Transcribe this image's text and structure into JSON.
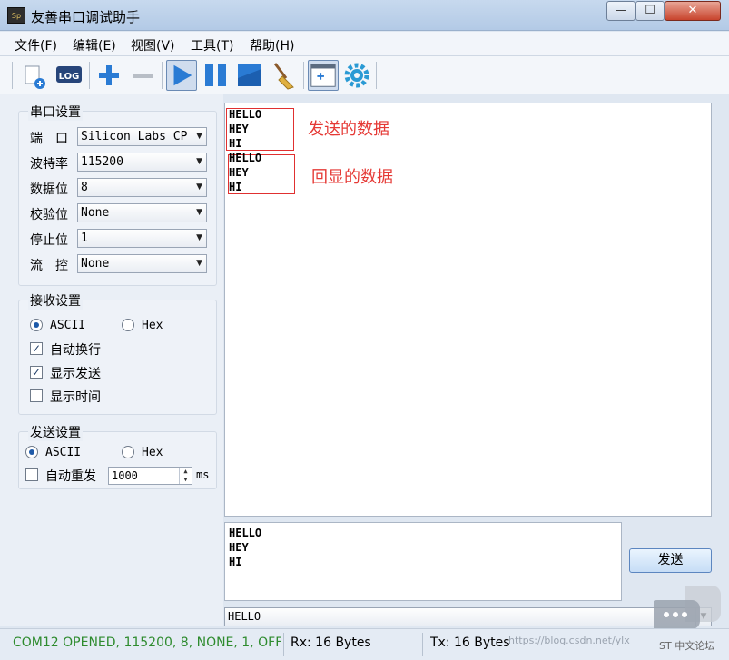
{
  "window": {
    "title": "友善串口调试助手",
    "app_icon_text": "Sp",
    "min_glyph": "—",
    "max_glyph": "☐",
    "close_glyph": "✕"
  },
  "menu": [
    "文件(F)",
    "编辑(E)",
    "视图(V)",
    "工具(T)",
    "帮助(H)"
  ],
  "toolbar": {
    "icons": [
      "new-icon",
      "log-icon",
      "add-icon",
      "remove-icon",
      "start-icon",
      "pause-icon",
      "stop-icon",
      "clear-broom-icon",
      "window-icon",
      "settings-gear-icon"
    ],
    "log_label": "LOG"
  },
  "serial_settings": {
    "title": "串口设置",
    "rows": [
      {
        "label": "端　口",
        "value": "Silicon Labs CP"
      },
      {
        "label": "波特率",
        "value": "115200"
      },
      {
        "label": "数据位",
        "value": "8"
      },
      {
        "label": "校验位",
        "value": "None"
      },
      {
        "label": "停止位",
        "value": "1"
      },
      {
        "label": "流　控",
        "value": "None"
      }
    ]
  },
  "receive_settings": {
    "title": "接收设置",
    "ascii": "ASCII",
    "hex": "Hex",
    "auto_newline": "自动换行",
    "show_sent": "显示发送",
    "show_time": "显示时间"
  },
  "send_settings": {
    "title": "发送设置",
    "ascii": "ASCII",
    "hex": "Hex",
    "auto_resend": "自动重发",
    "interval": "1000",
    "unit": "ms"
  },
  "receive_area": {
    "sent_lines": [
      "HELLO",
      "HEY",
      "HI"
    ],
    "echo_lines": [
      "HELLO",
      "HEY",
      "HI"
    ],
    "annotation_sent": "发送的数据",
    "annotation_echo": "回显的数据"
  },
  "send_area": {
    "lines": [
      "HELLO",
      "HEY",
      "HI"
    ],
    "button": "发送",
    "history_value": "HELLO"
  },
  "status": {
    "port": "COM12 OPENED, 115200, 8, NONE, 1, OFF",
    "rx": "Rx: 16 Bytes",
    "tx": "Tx: 16 Bytes"
  },
  "watermark": {
    "text": "ST 中文论坛",
    "url": "https://blog.csdn.net/ylx"
  },
  "colors": {
    "status_green": "#2e8b2e",
    "annotation_red": "#e53935",
    "toolbar_blue": "#2a7bd4"
  }
}
